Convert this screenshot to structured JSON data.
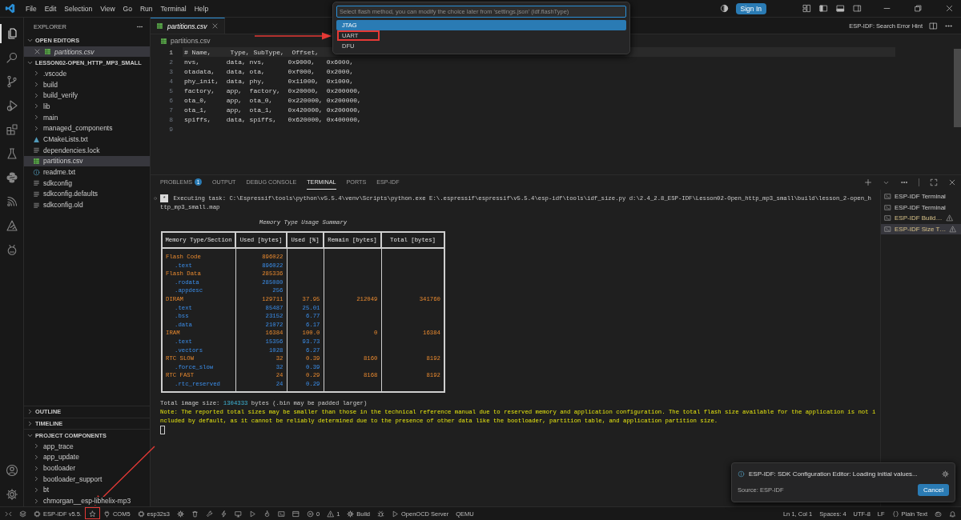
{
  "title_bar": {
    "menus": [
      "File",
      "Edit",
      "Selection",
      "View",
      "Go",
      "Run",
      "Terminal",
      "Help"
    ],
    "sign_in": "Sign In"
  },
  "quick_pick": {
    "placeholder": "Select flash method, you can modify the choice later from 'settings.json' (idf.flashType)",
    "items": [
      {
        "label": "JTAG",
        "selected": true,
        "highlighted": false
      },
      {
        "label": "UART",
        "selected": false,
        "highlighted": true
      },
      {
        "label": "DFU",
        "selected": false,
        "highlighted": false
      }
    ]
  },
  "activity_bar": {
    "items": [
      {
        "kind": "files",
        "selected": true
      },
      {
        "kind": "search",
        "selected": false
      },
      {
        "kind": "branch",
        "selected": false
      },
      {
        "kind": "play-bug",
        "selected": false
      },
      {
        "kind": "blocks",
        "selected": false
      },
      {
        "kind": "flask",
        "selected": false
      },
      {
        "kind": "snake",
        "selected": false
      },
      {
        "kind": "signal",
        "selected": false
      },
      {
        "kind": "triangle",
        "selected": false
      },
      {
        "kind": "bug-head",
        "selected": false
      }
    ],
    "bottom": [
      {
        "kind": "account"
      },
      {
        "kind": "gear"
      }
    ]
  },
  "sidebar": {
    "title": "EXPLORER",
    "open_editors": {
      "title": "OPEN EDITORS",
      "expanded": true,
      "files": [
        {
          "name": "partitions.csv",
          "kind": "csv",
          "selected": true
        }
      ]
    },
    "folder": {
      "title": "LESSON02-OPEN_HTTP_MP3_SMALL",
      "expanded": true,
      "items": [
        {
          "name": ".vscode",
          "kind": "folder",
          "expanded": false,
          "selected": false
        },
        {
          "name": "build",
          "kind": "folder",
          "expanded": false,
          "selected": false
        },
        {
          "name": "build_verify",
          "kind": "folder",
          "expanded": false,
          "selected": false
        },
        {
          "name": "lib",
          "kind": "folder",
          "expanded": false,
          "selected": false
        },
        {
          "name": "main",
          "kind": "folder",
          "expanded": false,
          "selected": false
        },
        {
          "name": "managed_components",
          "kind": "folder",
          "expanded": false,
          "selected": false
        },
        {
          "name": "CMakeLists.txt",
          "kind": "triangle-file",
          "selected": false
        },
        {
          "name": "dependencies.lock",
          "kind": "lines",
          "selected": false
        },
        {
          "name": "partitions.csv",
          "kind": "csv",
          "selected": true
        },
        {
          "name": "readme.txt",
          "kind": "info",
          "selected": false
        },
        {
          "name": "sdkconfig",
          "kind": "lines",
          "selected": false
        },
        {
          "name": "sdkconfig.defaults",
          "kind": "lines",
          "selected": false
        },
        {
          "name": "sdkconfig.old",
          "kind": "lines",
          "selected": false
        }
      ]
    },
    "sections": [
      {
        "title": "OUTLINE",
        "expanded": false
      },
      {
        "title": "TIMELINE",
        "expanded": false
      }
    ],
    "components": {
      "title": "PROJECT COMPONENTS",
      "expanded": true,
      "items": [
        {
          "name": "app_trace",
          "expanded": false
        },
        {
          "name": "app_update",
          "expanded": false
        },
        {
          "name": "bootloader",
          "expanded": false
        },
        {
          "name": "bootloader_support",
          "expanded": false
        },
        {
          "name": "bt",
          "expanded": false
        },
        {
          "name": "chmorgan__esp-libhelix-mp3",
          "expanded": false
        }
      ]
    }
  },
  "editor": {
    "tabs": [
      {
        "name": "partitions.csv",
        "selected": true
      }
    ],
    "breadcrumb": "partitions.csv",
    "action": "ESP-IDF: Search Error Hint",
    "lines": [
      {
        "number": "1",
        "text": "# Name,     Type, SubType,  Offset,",
        "current": true
      },
      {
        "number": "2",
        "text": "nvs,       data, nvs,      0x9000,   0x6000,",
        "current": false
      },
      {
        "number": "3",
        "text": "otadata,   data, ota,      0xf000,   0x2000,",
        "current": false
      },
      {
        "number": "4",
        "text": "phy_init,  data, phy,      0x11000,  0x1000,",
        "current": false
      },
      {
        "number": "5",
        "text": "factory,   app,  factory,  0x20000,  0x200000,",
        "current": false
      },
      {
        "number": "6",
        "text": "ota_0,     app,  ota_0,    0x220000, 0x200000,",
        "current": false
      },
      {
        "number": "7",
        "text": "ota_1,     app,  ota_1,    0x420000, 0x200000,",
        "current": false
      },
      {
        "number": "8",
        "text": "spiffs,    data, spiffs,   0x620000, 0x400000,",
        "current": false
      },
      {
        "number": "9",
        "current": false
      }
    ]
  },
  "panel": {
    "tabs": [
      {
        "label": "PROBLEMS",
        "badge": "1",
        "selected": false
      },
      {
        "label": "OUTPUT",
        "selected": false
      },
      {
        "label": "DEBUG CONSOLE",
        "selected": false
      },
      {
        "label": "TERMINAL",
        "selected": true
      },
      {
        "label": "PORTS",
        "selected": false
      },
      {
        "label": "ESP-IDF",
        "selected": false
      }
    ],
    "terminal": {
      "task_marker": "*",
      "lines": [
        "Executing task: C:\\Espressif\\tools\\python\\v5.5.4\\venv\\Scripts\\python.exe E:\\.espressif\\espressif\\v5.5.4\\esp-idf\\tools\\idf_size.py d:\\2.4_2.8_ESP-IDF\\Lesson02-Open_http_mp3_small\\build\\lesson_2-open_h",
        "ttp_mp3_small.map"
      ],
      "table": {
        "title": "Memory Type Usage Summary",
        "columns": [
          "Memory Type/Section",
          "Used [bytes]",
          "Used [%]",
          "Remain [bytes]",
          "Total [bytes]"
        ],
        "rows": [
          {
            "kind": "section",
            "name": "Flash Code",
            "used_bytes": "896022"
          },
          {
            "kind": "part",
            "name": ".text",
            "used_bytes": "896022"
          },
          {
            "kind": "section",
            "name": "Flash Data",
            "used_bytes": "285336"
          },
          {
            "kind": "part",
            "name": ".rodata",
            "used_bytes": "285080"
          },
          {
            "kind": "part",
            "name": ".appdesc",
            "used_bytes": "256"
          },
          {
            "kind": "section",
            "name": "DIRAM",
            "used_bytes": "129711",
            "used_pct": "37.95",
            "remain": "212049",
            "total": "341760"
          },
          {
            "kind": "part",
            "name": ".text",
            "used_bytes": "85487",
            "used_pct": "25.01"
          },
          {
            "kind": "part",
            "name": ".bss",
            "used_bytes": "23152",
            "used_pct": "6.77"
          },
          {
            "kind": "part",
            "name": ".data",
            "used_bytes": "21072",
            "used_pct": "6.17"
          },
          {
            "kind": "section",
            "name": "IRAM",
            "used_bytes": "16384",
            "used_pct": "100.0",
            "remain": "0",
            "total": "16384"
          },
          {
            "kind": "part",
            "name": ".text",
            "used_bytes": "15356",
            "used_pct": "93.73"
          },
          {
            "kind": "part",
            "name": ".vectors",
            "used_bytes": "1028",
            "used_pct": "6.27"
          },
          {
            "kind": "section",
            "name": "RTC SLOW",
            "used_bytes": "32",
            "used_pct": "0.39",
            "remain": "8160",
            "total": "8192"
          },
          {
            "kind": "part",
            "name": ".force_slow",
            "used_bytes": "32",
            "used_pct": "0.39"
          },
          {
            "kind": "section",
            "name": "RTC FAST",
            "used_bytes": "24",
            "used_pct": "0.29",
            "remain": "8168",
            "total": "8192"
          },
          {
            "kind": "part",
            "name": ".rtc_reserved",
            "used_bytes": "24",
            "used_pct": "0.29"
          }
        ]
      },
      "total": {
        "label": "Total image size:",
        "value": "1304333",
        "suffix": "bytes (.bin may be padded larger)"
      },
      "note_lines": [
        "Note: The reported total sizes may be smaller than those in the technical reference manual due to reserved memory and application configuration. The total flash size available for the application is not i",
        "ncluded by default, as it cannot be reliably determined due to the presence of other data like the bootloader, partition table, and application partition size."
      ],
      "cursor": true
    },
    "terminal_list": [
      {
        "label": "ESP-IDF Terminal",
        "selected": false,
        "warning": false
      },
      {
        "label": "ESP-IDF Terminal",
        "selected": false,
        "warning": false
      },
      {
        "label": "ESP-IDF Build…",
        "selected": false,
        "warning": true
      },
      {
        "label": "ESP-IDF Size T…",
        "selected": true,
        "warning": true
      }
    ]
  },
  "notification": {
    "message": "ESP-IDF: SDK Configuration Editor: Loading initial values...",
    "source": "Source: ESP-IDF",
    "button": "Cancel"
  },
  "status_bar": {
    "left": [
      {
        "kind": "remote",
        "highlighted": false
      },
      {
        "kind": "layers",
        "highlighted": false
      },
      {
        "kind": "chip",
        "text": "ESP-IDF v5.5.",
        "highlighted": false
      },
      {
        "kind": "star",
        "highlighted": true
      },
      {
        "kind": "plug",
        "text": "COM5",
        "highlighted": false
      },
      {
        "kind": "chip",
        "text": "esp32s3",
        "highlighted": false
      },
      {
        "kind": "gear",
        "highlighted": false
      },
      {
        "kind": "trash",
        "highlighted": false
      },
      {
        "kind": "wrench",
        "highlighted": false
      },
      {
        "kind": "bolt",
        "highlighted": false
      },
      {
        "kind": "monitor",
        "highlighted": false
      },
      {
        "kind": "play",
        "highlighted": false
      },
      {
        "kind": "flame",
        "highlighted": false
      },
      {
        "kind": "terminal",
        "highlighted": false
      },
      {
        "kind": "box",
        "highlighted": false
      },
      {
        "kind": "error",
        "text": "0",
        "highlighted": false
      },
      {
        "kind": "warning",
        "text": "1",
        "highlighted": false
      },
      {
        "kind": "gear",
        "text": "Build",
        "highlighted": false
      },
      {
        "kind": "bug",
        "highlighted": false
      },
      {
        "kind": "play",
        "text": "OpenOCD Server",
        "highlighted": false
      },
      {
        "kind": "none",
        "text": "QEMU",
        "highlighted": false
      }
    ],
    "right": [
      {
        "kind": "none",
        "text": "Ln 1, Col 1"
      },
      {
        "kind": "none",
        "text": "Spaces: 4"
      },
      {
        "kind": "none",
        "text": "UTF-8"
      },
      {
        "kind": "none",
        "text": "LF"
      },
      {
        "kind": "braces",
        "text": "Plain Text"
      },
      {
        "kind": "robot"
      },
      {
        "kind": "bell"
      }
    ]
  }
}
